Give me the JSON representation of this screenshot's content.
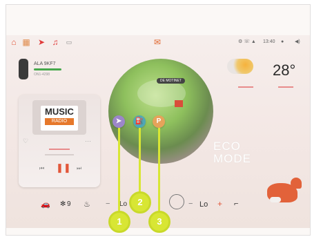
{
  "topbar": {
    "icons": [
      "home-icon",
      "apps-icon",
      "navigation-icon",
      "music-icon",
      "camera-icon"
    ],
    "center_icon": "notification-icon",
    "time": "13:40"
  },
  "car_card": {
    "plate": "ALA 9KF7",
    "sub": "ON1-4298"
  },
  "weather": {
    "temperature": "28°"
  },
  "music": {
    "logo_main": "MUSIC",
    "logo_sub": "RADIO"
  },
  "globe": {
    "bubble": "DE MOTINET",
    "eco_line1": "ECO",
    "eco_line2": "MODE"
  },
  "pins": [
    {
      "name": "navigation-pin",
      "glyph": "➤",
      "color": "#9c86c9"
    },
    {
      "name": "fuel-pin",
      "glyph": "⛽",
      "color": "#4ea7b6"
    },
    {
      "name": "parking-pin",
      "glyph": "P",
      "color": "#e6a35a"
    }
  ],
  "bottombar": {
    "fan_level": "9",
    "left_temp": "Lo",
    "right_temp": "Lo",
    "minus": "−",
    "plus": "+"
  },
  "callouts": [
    "1",
    "2",
    "3"
  ]
}
